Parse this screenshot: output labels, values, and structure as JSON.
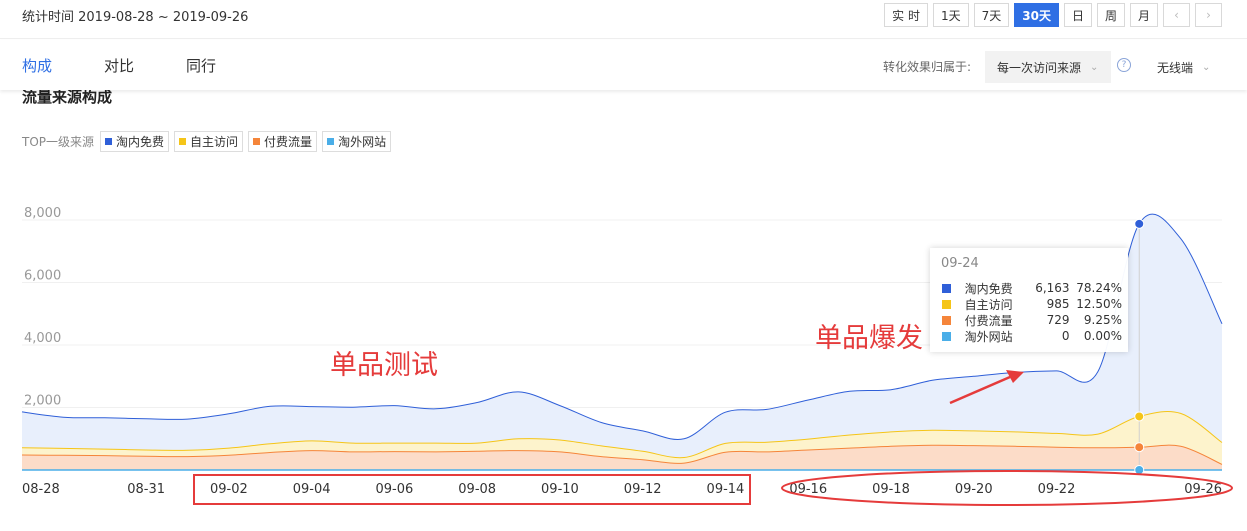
{
  "header": {
    "period": "统计时间 2019-08-28 ~ 2019-09-26",
    "range_buttons": [
      "实 时",
      "1天",
      "7天",
      "30天",
      "日",
      "周",
      "月"
    ],
    "active_range": "30天",
    "prev_icon": "chevron-left-icon",
    "next_icon": "chevron-right-icon"
  },
  "tabs": [
    {
      "label": "构成",
      "active": true
    },
    {
      "label": "对比",
      "active": false
    },
    {
      "label": "同行",
      "active": false
    }
  ],
  "attribution": {
    "label": "转化效果归属于:",
    "selected": "每一次访问来源",
    "device": "无线端"
  },
  "section_title": "流量来源构成",
  "legend": {
    "label": "TOP一级来源",
    "items": [
      {
        "name": "淘内免费",
        "color": "#2f5fd8"
      },
      {
        "name": "自主访问",
        "color": "#f5c518"
      },
      {
        "name": "付费流量",
        "color": "#f5853a"
      },
      {
        "name": "淘外网站",
        "color": "#4aaee8"
      }
    ]
  },
  "chart_data": {
    "type": "area",
    "stacked": true,
    "y_ticks": [
      "8,000",
      "6,000",
      "4,000",
      "2,000",
      "0"
    ],
    "ylim": [
      0,
      8000
    ],
    "x_tick_labels": [
      "08-28",
      "08-31",
      "09-02",
      "09-04",
      "09-06",
      "09-08",
      "09-10",
      "09-12",
      "09-14",
      "09-16",
      "09-18",
      "09-20",
      "09-22",
      "09-26"
    ],
    "x": [
      "08-28",
      "08-29",
      "08-30",
      "08-31",
      "09-01",
      "09-02",
      "09-03",
      "09-04",
      "09-05",
      "09-06",
      "09-07",
      "09-08",
      "09-09",
      "09-10",
      "09-11",
      "09-12",
      "09-13",
      "09-14",
      "09-15",
      "09-16",
      "09-17",
      "09-18",
      "09-19",
      "09-20",
      "09-21",
      "09-22",
      "09-23",
      "09-24",
      "09-25",
      "09-26"
    ],
    "series": [
      {
        "name": "淘内免费",
        "color": "#2f5fd8",
        "values": [
          1150,
          1000,
          1000,
          1000,
          1000,
          1100,
          1200,
          1100,
          1150,
          1200,
          1100,
          1300,
          1500,
          1100,
          750,
          650,
          600,
          1000,
          1050,
          1250,
          1400,
          1350,
          1600,
          1750,
          1900,
          2000,
          2000,
          6163,
          5600,
          3800
        ]
      },
      {
        "name": "自主访问",
        "color": "#f5c518",
        "values": [
          230,
          220,
          210,
          200,
          200,
          230,
          280,
          310,
          280,
          270,
          280,
          260,
          380,
          380,
          340,
          270,
          180,
          280,
          310,
          350,
          420,
          460,
          480,
          470,
          460,
          440,
          440,
          985,
          1050,
          700
        ]
      },
      {
        "name": "付费流量",
        "color": "#f5853a",
        "values": [
          480,
          470,
          460,
          440,
          430,
          470,
          560,
          620,
          580,
          590,
          580,
          600,
          620,
          580,
          430,
          330,
          220,
          570,
          580,
          640,
          700,
          760,
          790,
          780,
          760,
          730,
          710,
          729,
          760,
          180
        ]
      },
      {
        "name": "淘外网站",
        "color": "#4aaee8",
        "values": [
          0,
          0,
          0,
          0,
          0,
          0,
          0,
          0,
          0,
          0,
          0,
          0,
          0,
          0,
          0,
          0,
          0,
          0,
          0,
          0,
          0,
          0,
          0,
          0,
          0,
          0,
          0,
          0,
          0,
          0
        ]
      }
    ]
  },
  "tooltip": {
    "date": "09-24",
    "rows": [
      {
        "name": "淘内免费",
        "value": "6,163",
        "pct": "78.24%",
        "color": "#2f5fd8"
      },
      {
        "name": "自主访问",
        "value": "985",
        "pct": "12.50%",
        "color": "#f5c518"
      },
      {
        "name": "付费流量",
        "value": "729",
        "pct": "9.25%",
        "color": "#f5853a"
      },
      {
        "name": "淘外网站",
        "value": "0",
        "pct": "0.00%",
        "color": "#4aaee8"
      }
    ]
  },
  "annotations": {
    "test_label": "单品测试",
    "burst_label": "单品爆发",
    "color": "#e53b3b"
  }
}
